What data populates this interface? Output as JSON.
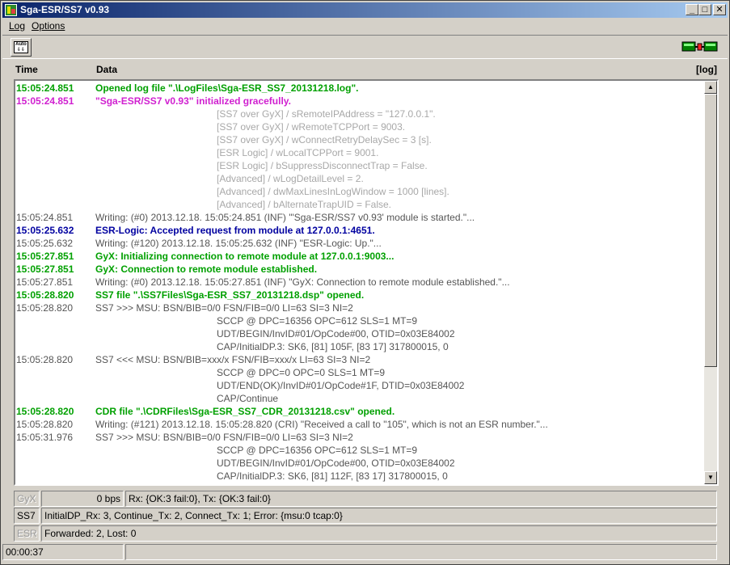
{
  "window": {
    "title": "Sga-ESR/SS7  v0.93",
    "minimize_glyph": "_",
    "maximize_glyph": "□",
    "close_glyph": "✕"
  },
  "menu": {
    "log_label": "Log",
    "options_label": "Options"
  },
  "toolbar": {
    "auto_label": "Auto"
  },
  "log_header": {
    "time_label": "Time",
    "data_label": "Data",
    "log_button_label": "[log]"
  },
  "log_rows": [
    {
      "time": "15:05:24.851",
      "text": "Opened log file \".\\LogFiles\\Sga-ESR_SS7_20131218.log\".",
      "style": "green"
    },
    {
      "time": "15:05:24.851",
      "text": "\"Sga-ESR/SS7  v0.93\" initialized gracefully.",
      "style": "magenta"
    },
    {
      "time": "",
      "text": "[SS7 over GyX] / sRemoteIPAddress = \"127.0.0.1\".",
      "style": "lightgray",
      "cont": true
    },
    {
      "time": "",
      "text": "[SS7 over GyX] / wRemoteTCPPort = 9003.",
      "style": "lightgray",
      "cont": true
    },
    {
      "time": "",
      "text": "[SS7 over GyX] / wConnectRetryDelaySec = 3 [s].",
      "style": "lightgray",
      "cont": true
    },
    {
      "time": "",
      "text": "[ESR Logic] / wLocalTCPPort = 9001.",
      "style": "lightgray",
      "cont": true
    },
    {
      "time": "",
      "text": "[ESR Logic] / bSuppressDisconnectTrap = False.",
      "style": "lightgray",
      "cont": true
    },
    {
      "time": "",
      "text": "[Advanced] / wLogDetailLevel = 2.",
      "style": "lightgray",
      "cont": true
    },
    {
      "time": "",
      "text": "[Advanced] / dwMaxLinesInLogWindow = 1000 [lines].",
      "style": "lightgray",
      "cont": true
    },
    {
      "time": "",
      "text": "[Advanced] / bAlternateTrapUID = False.",
      "style": "lightgray",
      "cont": true
    },
    {
      "time": "15:05:24.851",
      "text": "Writing: (#0) 2013.12.18. 15:05:24.851 (INF) '\"Sga-ESR/SS7  v0.93' module is started.\"...",
      "style": "gray"
    },
    {
      "time": "15:05:25.632",
      "text": "ESR-Logic: Accepted request from module at 127.0.0.1:4651.",
      "style": "blue"
    },
    {
      "time": "15:05:25.632",
      "text": "Writing: (#120) 2013.12.18. 15:05:25.632 (INF) \"ESR-Logic: Up.\"...",
      "style": "gray"
    },
    {
      "time": "15:05:27.851",
      "text": "GyX: Initializing connection to remote module at 127.0.0.1:9003...",
      "style": "green"
    },
    {
      "time": "15:05:27.851",
      "text": "GyX: Connection to remote module established.",
      "style": "green"
    },
    {
      "time": "15:05:27.851",
      "text": "Writing: (#0) 2013.12.18. 15:05:27.851 (INF) \"GyX: Connection to remote module established.\"...",
      "style": "gray"
    },
    {
      "time": "15:05:28.820",
      "text": "SS7 file \".\\SS7Files\\Sga-ESR_SS7_20131218.dsp\" opened.",
      "style": "green"
    },
    {
      "time": "15:05:28.820",
      "text": "SS7 >>> MSU: BSN/BIB=0/0 FSN/FIB=0/0 LI=63 SI=3 NI=2",
      "style": "gray"
    },
    {
      "time": "",
      "text": "SCCP @ DPC=16356 OPC=612 SLS=1 MT=9",
      "style": "gray",
      "cont": true
    },
    {
      "time": "",
      "text": "UDT/BEGIN/InvID#01/OpCode#00, OTID=0x03E84002",
      "style": "gray",
      "cont": true
    },
    {
      "time": "",
      "text": "CAP/InitialDP.3: SK6, [81] 105F, [83 17] 317800015, 0",
      "style": "gray",
      "cont": true
    },
    {
      "time": "15:05:28.820",
      "text": "SS7 <<< MSU: BSN/BIB=xxx/x FSN/FIB=xxx/x LI=63 SI=3 NI=2",
      "style": "gray"
    },
    {
      "time": "",
      "text": "SCCP @ DPC=0 OPC=0 SLS=1 MT=9",
      "style": "gray",
      "cont": true
    },
    {
      "time": "",
      "text": "UDT/END(OK)/InvID#01/OpCode#1F, DTID=0x03E84002",
      "style": "gray",
      "cont": true
    },
    {
      "time": "",
      "text": "CAP/Continue",
      "style": "gray",
      "cont": true
    },
    {
      "time": "15:05:28.820",
      "text": "CDR file \".\\CDRFiles\\Sga-ESR_SS7_CDR_20131218.csv\" opened.",
      "style": "green"
    },
    {
      "time": "15:05:28.820",
      "text": "Writing: (#121) 2013.12.18. 15:05:28.820 (CRI) \"Received a call to \"105\", which is not an ESR number.\"...",
      "style": "gray"
    },
    {
      "time": "15:05:31.976",
      "text": "SS7 >>> MSU: BSN/BIB=0/0 FSN/FIB=0/0 LI=63 SI=3 NI=2",
      "style": "gray"
    },
    {
      "time": "",
      "text": "SCCP @ DPC=16356 OPC=612 SLS=1 MT=9",
      "style": "gray",
      "cont": true
    },
    {
      "time": "",
      "text": "UDT/BEGIN/InvID#01/OpCode#00, OTID=0x03E84002",
      "style": "gray",
      "cont": true
    },
    {
      "time": "",
      "text": "CAP/InitialDP.3: SK6, [81] 112F, [83 17] 317800015, 0",
      "style": "gray",
      "cont": true
    }
  ],
  "scroll": {
    "up_glyph": "▲",
    "down_glyph": "▼"
  },
  "status": {
    "gyx_label": "GyX",
    "gyx_rate": "0 bps",
    "gyx_counts": "Rx: {OK:3  fail:0},  Tx: {OK:3  fail:0}",
    "ss7_label": "SS7",
    "ss7_counts": "InitialDP_Rx: 3,  Continue_Tx: 2,  Connect_Tx: 1;  Error: {msu:0  tcap:0}",
    "esr_label": "ESR",
    "esr_counts": "Forwarded: 2,  Lost: 0",
    "uptime": "00:00:37",
    "message": ""
  },
  "colors": {
    "green": "#00a000",
    "magenta": "#d020d0",
    "blue": "#0000a0",
    "gray": "#555555",
    "lightgray": "#a8a8a8"
  }
}
